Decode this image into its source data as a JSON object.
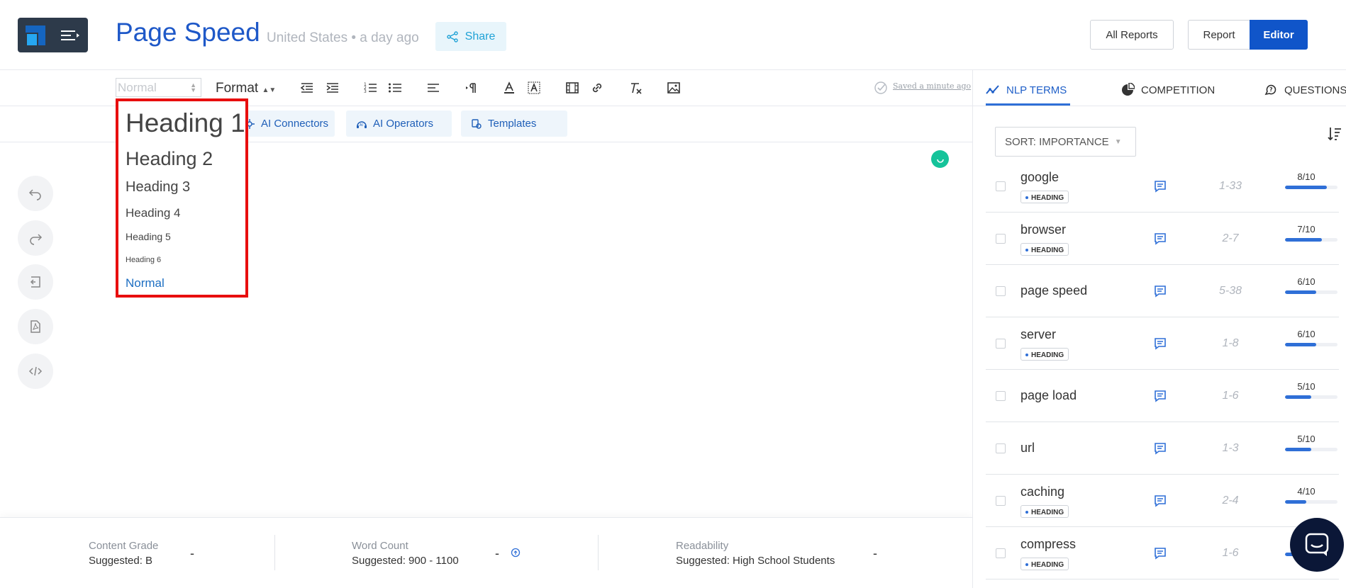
{
  "header": {
    "title": "Page Speed",
    "meta": "United States • a day ago",
    "share_label": "Share",
    "all_reports_label": "All Reports",
    "report_label": "Report",
    "editor_label": "Editor"
  },
  "toolbar": {
    "format_select_value": "Normal",
    "format_label": "Format",
    "saved_text": "Saved a minute ago"
  },
  "ai_toolbar": {
    "connectors_label": "AI Connectors",
    "operators_label": "AI Operators",
    "templates_label": "Templates"
  },
  "heading_dropdown": {
    "options": [
      "Heading 1",
      "Heading 2",
      "Heading 3",
      "Heading 4",
      "Heading 5",
      "Heading 6",
      "Normal"
    ]
  },
  "footer": {
    "content_grade_label": "Content Grade",
    "content_grade_suggested": "Suggested: B",
    "content_grade_value": "-",
    "word_count_label": "Word Count",
    "word_count_suggested": "Suggested: 900 - 1100",
    "word_count_value": "-",
    "readability_label": "Readability",
    "readability_suggested": "Suggested: High School Students",
    "readability_value": "-"
  },
  "right_panel": {
    "tabs": [
      {
        "label": "NLP TERMS",
        "icon": "trend-icon",
        "active": true
      },
      {
        "label": "COMPETITION",
        "icon": "pie-chart-icon",
        "active": false
      },
      {
        "label": "QUESTIONS",
        "icon": "question-bubble-icon",
        "active": false
      }
    ],
    "sort_label": "SORT: IMPORTANCE",
    "badge_label": "HEADING",
    "terms": [
      {
        "name": "google",
        "heading": true,
        "range": "1-33",
        "score": "8/10",
        "fill": 0.8
      },
      {
        "name": "browser",
        "heading": true,
        "range": "2-7",
        "score": "7/10",
        "fill": 0.7
      },
      {
        "name": "page speed",
        "heading": false,
        "range": "5-38",
        "score": "6/10",
        "fill": 0.6
      },
      {
        "name": "server",
        "heading": true,
        "range": "1-8",
        "score": "6/10",
        "fill": 0.6
      },
      {
        "name": "page load",
        "heading": false,
        "range": "1-6",
        "score": "5/10",
        "fill": 0.5
      },
      {
        "name": "url",
        "heading": false,
        "range": "1-3",
        "score": "5/10",
        "fill": 0.5
      },
      {
        "name": "caching",
        "heading": true,
        "range": "2-4",
        "score": "4/10",
        "fill": 0.4
      },
      {
        "name": "compress",
        "heading": true,
        "range": "1-6",
        "score": "",
        "fill": 0.4
      }
    ]
  },
  "colors": {
    "brand_blue": "#1e58c8",
    "editor_button": "#1055c9",
    "dropdown_highlight": "#e80e0e",
    "bar_fill": "#2f6fd7"
  }
}
